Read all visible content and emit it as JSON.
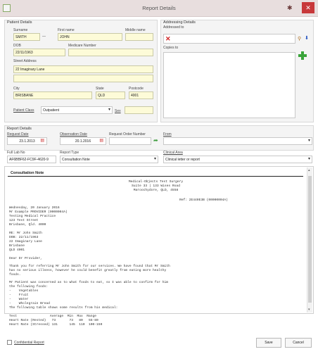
{
  "window": {
    "title": "Report Details"
  },
  "patient": {
    "legend": "Patient Details",
    "surname_label": "Surname",
    "surname": "SMITH",
    "surname_dash": "—",
    "firstname_label": "First name",
    "firstname": "JOHN",
    "middlename_label": "Middle name",
    "middlename": "",
    "dob_label": "DOB",
    "dob": "22/11/1963",
    "medicare_label": "Medicare Number",
    "medicare": "",
    "street_label": "Street Address",
    "street": "22 Imaginary Lane",
    "city_label": "City",
    "city": "BRISBANE",
    "state_label": "State",
    "state": "QLD",
    "postcode_label": "Postcode",
    "postcode": "4001",
    "class_label": "Patient Class",
    "class": "Outpatient",
    "sex_label": "Sex",
    "sex": ""
  },
  "addressing": {
    "legend": "Addressing Details",
    "addressed_to_label": "Addressed to",
    "copies_to_label": "Copies to"
  },
  "report": {
    "legend": "Report Details",
    "request_date_label": "Request Date",
    "request_date": "23.1.2013",
    "observation_date_label": "Observation Date",
    "observation_date": "20.1.2016",
    "order_number_label": "Request Order Number",
    "order_number": "",
    "from_label": "From",
    "from": "",
    "lab_no_label": "Full Lab No",
    "lab_no": "AF6BBF62-FC9F-4620-9",
    "report_type_label": "Report Type",
    "report_type": "Consultation Note",
    "clinical_area_label": "Clinical Area",
    "clinical_area": "Clinical letter or report"
  },
  "document": {
    "heading": "Consultation Note",
    "practice_name": "Medical-Objects Test Surgery",
    "practice_addr1": "Suite 33 | 133 Wises Road",
    "practice_addr2": "Maroochydore, QLD, 4558",
    "ref": "Ref: 2E440E3B (00000004A)",
    "date_line": "Wednesday, 20 January 2016",
    "to_name": "Mr Example PROVIDER (0000004A)",
    "to_practice": "Testing Medical Practice",
    "to_street": "123 Test Street",
    "to_city": "Brisbane, Qld. 4000",
    "re_line": "RE: Mr John Smith",
    "re_dob": "DOB: 22/11/1963",
    "re_street": "22 Imaginary Lane",
    "re_city": "Brisbane",
    "re_state": "QLD 4001",
    "salutation": "Dear Dr Provider,",
    "para1a": "Thank you for referring Mr John Smith for our services. We have found that Mr Smith",
    "para1b": "has no serious illness, however he could benefit greatly from eating more healthy",
    "para1c": "foods.",
    "para2a": "Mr Patient was concerned as to what foods to eat, so I was able to confirm for him",
    "para2b": "the following foods:",
    "food1": "-    Vegetables",
    "food2": "-    Fruit",
    "food3": "-    Water",
    "food4": "-    Wholegrain Bread",
    "table_intro": "The following table shows some results from his medical:",
    "table_header": "Test                 Average  Min  Max  Range",
    "table_row1": "Heart Rate (Rested)   73       73   80   55-80",
    "table_row2": "Heart Rate (Stressed) 131      145  110  100-150"
  },
  "footer": {
    "confidential_label": "Confidential Report",
    "save_label": "Save",
    "cancel_label": "Cancel"
  },
  "colors": {
    "close": "#c8383a",
    "field_yellow": "#fdfbd8",
    "add_green": "#3aa43a"
  }
}
